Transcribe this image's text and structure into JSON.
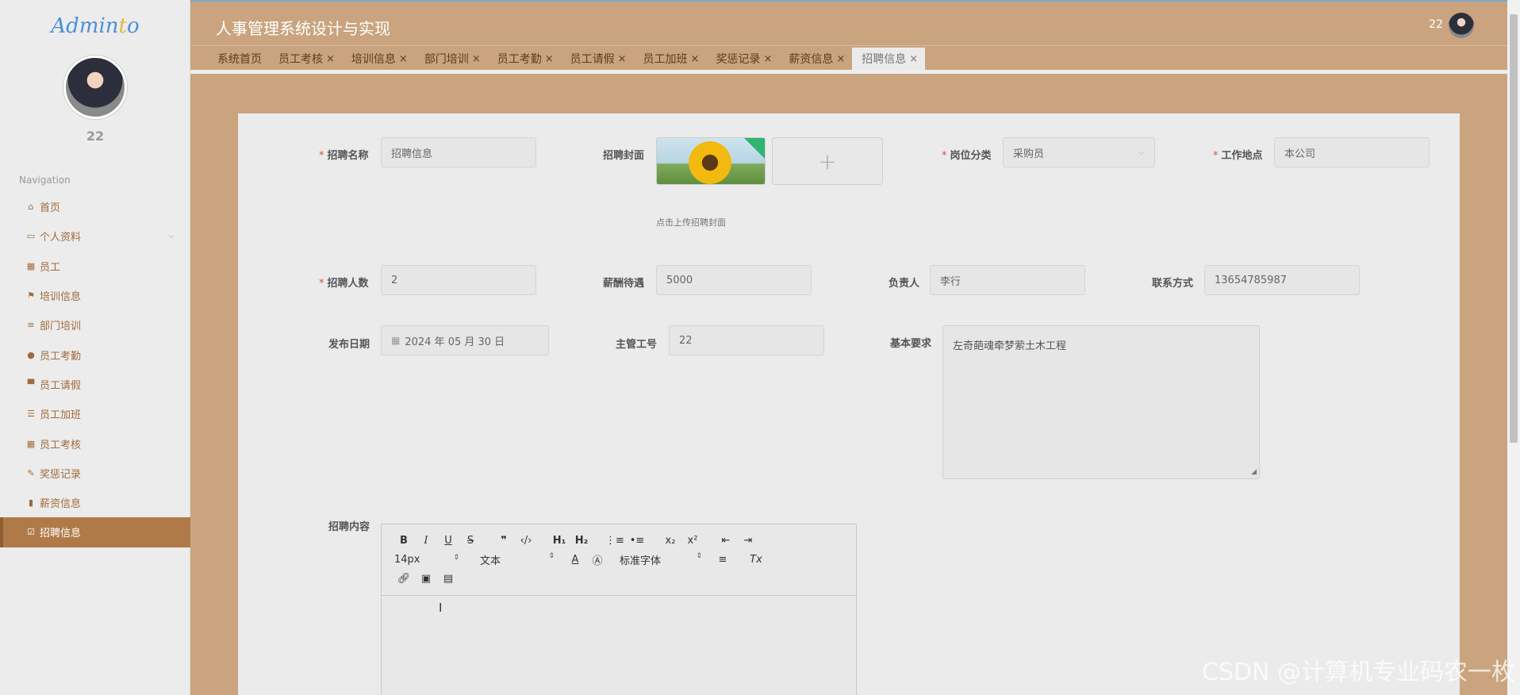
{
  "sidebar": {
    "logo_main": "Admin",
    "logo_o": "t",
    "logo_tail": "o",
    "user": "22",
    "nav_title": "Navigation",
    "items": [
      {
        "label": "首页",
        "icon": "home-icon",
        "glyph": "⌂"
      },
      {
        "label": "个人资料",
        "icon": "profile-card-icon",
        "glyph": "▭"
      },
      {
        "label": "员工",
        "icon": "grid-icon",
        "glyph": "▦"
      },
      {
        "label": "培训信息",
        "icon": "flag-icon",
        "glyph": "⚑"
      },
      {
        "label": "部门培训",
        "icon": "sliders-icon",
        "glyph": "≡"
      },
      {
        "label": "员工考勤",
        "icon": "user-icon",
        "glyph": "●"
      },
      {
        "label": "员工请假",
        "icon": "comment-icon",
        "glyph": "▀"
      },
      {
        "label": "员工加班",
        "icon": "list-icon",
        "glyph": "☰"
      },
      {
        "label": "员工考核",
        "icon": "grid-icon",
        "glyph": "▦"
      },
      {
        "label": "奖惩记录",
        "icon": "thumbs-icon",
        "glyph": "✎"
      },
      {
        "label": "薪资信息",
        "icon": "bar-chart-icon",
        "glyph": "▮"
      },
      {
        "label": "招聘信息",
        "icon": "checkbox-icon",
        "glyph": "☑"
      }
    ]
  },
  "header": {
    "title": "人事管理系统设计与实现",
    "user": "22"
  },
  "tabs": [
    "系统首页",
    "员工考核",
    "培训信息",
    "部门培训",
    "员工考勤",
    "员工请假",
    "员工加班",
    "奖惩记录",
    "薪资信息",
    "招聘信息"
  ],
  "form": {
    "name_label": "招聘名称",
    "name_value": "招聘信息",
    "cover_label": "招聘封面",
    "upload_plus": "+",
    "upload_tip": "点击上传招聘封面",
    "category_label": "岗位分类",
    "category_value": "采购员",
    "location_label": "工作地点",
    "location_value": "本公司",
    "count_label": "招聘人数",
    "count_value": "2",
    "salary_label": "薪酬待遇",
    "salary_value": "5000",
    "manager_label": "负责人",
    "manager_value": "李行",
    "contact_label": "联系方式",
    "contact_value": "13654785987",
    "date_label": "发布日期",
    "date_value": "2024 年 05 月 30 日",
    "supervisor_label": "主管工号",
    "supervisor_value": "22",
    "requirement_label": "基本要求",
    "requirement_value": "左奇葩魂牵梦萦土木工程",
    "content_label": "招聘内容"
  },
  "editor": {
    "font_size": "14px",
    "format": "文本",
    "font_family": "标准字体"
  },
  "watermark": "CSDN @计算机专业码农一枚"
}
